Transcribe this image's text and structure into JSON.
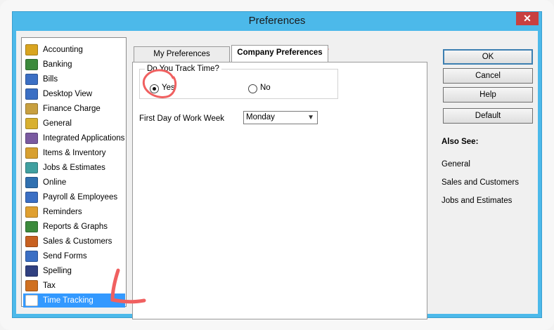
{
  "window": {
    "title": "Preferences",
    "close_label": "✕"
  },
  "sidebar": {
    "items": [
      {
        "label": "Accounting",
        "icon": "accounting-icon",
        "color": "#d9a520"
      },
      {
        "label": "Banking",
        "icon": "banking-icon",
        "color": "#3c8a3c"
      },
      {
        "label": "Bills",
        "icon": "bills-icon",
        "color": "#3b6fc4"
      },
      {
        "label": "Desktop View",
        "icon": "desktop-view-icon",
        "color": "#3b6fc4"
      },
      {
        "label": "Finance Charge",
        "icon": "finance-charge-icon",
        "color": "#c8a040"
      },
      {
        "label": "General",
        "icon": "general-icon",
        "color": "#d8b030"
      },
      {
        "label": "Integrated Applications",
        "icon": "integrated-applications-icon",
        "color": "#7a5aa0"
      },
      {
        "label": "Items & Inventory",
        "icon": "items-inventory-icon",
        "color": "#d8a030"
      },
      {
        "label": "Jobs & Estimates",
        "icon": "jobs-estimates-icon",
        "color": "#40a0a0"
      },
      {
        "label": "Online",
        "icon": "online-icon",
        "color": "#3070b0"
      },
      {
        "label": "Payroll & Employees",
        "icon": "payroll-employees-icon",
        "color": "#3b6fc4"
      },
      {
        "label": "Reminders",
        "icon": "reminders-icon",
        "color": "#e0a030"
      },
      {
        "label": "Reports & Graphs",
        "icon": "reports-graphs-icon",
        "color": "#3c8a3c"
      },
      {
        "label": "Sales & Customers",
        "icon": "sales-customers-icon",
        "color": "#c86020"
      },
      {
        "label": "Send Forms",
        "icon": "send-forms-icon",
        "color": "#3b6fc4"
      },
      {
        "label": "Spelling",
        "icon": "spelling-icon",
        "color": "#304080"
      },
      {
        "label": "Tax",
        "icon": "tax-icon",
        "color": "#d07020"
      },
      {
        "label": "Time Tracking",
        "icon": "time-tracking-icon",
        "color": "#ffffff"
      }
    ],
    "selected": "Time Tracking"
  },
  "tabs": {
    "my_prefs": "My Preferences",
    "company_prefs": "Company Preferences",
    "active": "Company Preferences"
  },
  "panel": {
    "group_title": "Do You Track Time?",
    "yes_label": "Yes",
    "no_label": "No",
    "selected_option": "Yes",
    "work_week_label": "First Day of Work Week",
    "work_week_value": "Monday"
  },
  "buttons": {
    "ok": "OK",
    "cancel": "Cancel",
    "help": "Help",
    "default": "Default"
  },
  "also_see": {
    "title": "Also See:",
    "links": [
      "General",
      "Sales and Customers",
      "Jobs and Estimates"
    ]
  },
  "colors": {
    "title_bar": "#4cb9ea",
    "selection": "#3399ff",
    "annotation": "#f06060"
  }
}
